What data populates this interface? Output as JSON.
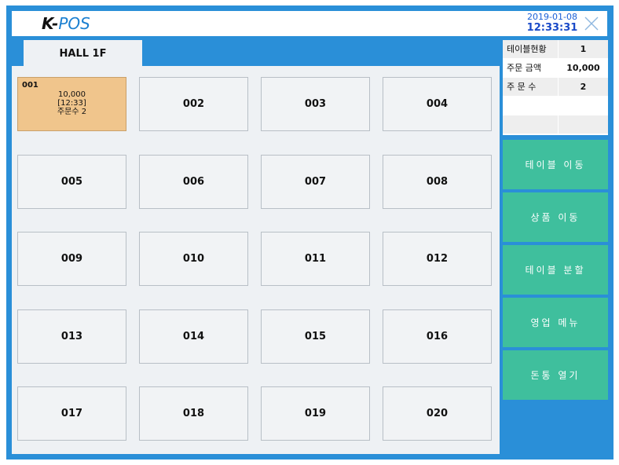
{
  "app": {
    "logo_k": "K-",
    "logo_pos": "POS",
    "date": "2019-01-08",
    "time": "12:33:31",
    "close_icon": "close-icon"
  },
  "colors": {
    "frame": "#2a8fd8",
    "occupied": "#f0c58c",
    "action": "#3fbf9d",
    "area": "#eef1f4"
  },
  "floor_tab": {
    "label": "HALL 1F"
  },
  "occupied_table": {
    "number": "001",
    "amount": "10,000",
    "time": "[12:33]",
    "orders": "주문수 2"
  },
  "tables": [
    "002",
    "003",
    "004",
    "005",
    "006",
    "007",
    "008",
    "009",
    "010",
    "011",
    "012",
    "013",
    "014",
    "015",
    "016",
    "017",
    "018",
    "019",
    "020"
  ],
  "info_panel": {
    "rows": [
      {
        "label": "테이블현황",
        "value": "1"
      },
      {
        "label": "주문 금액",
        "value": "10,000"
      },
      {
        "label": "주 문 수",
        "value": "2"
      },
      {
        "label": "",
        "value": ""
      },
      {
        "label": "",
        "value": ""
      }
    ]
  },
  "actions": [
    "테이블 이동",
    "상품 이동",
    "테이블 분할",
    "영업 메뉴",
    "돈통 열기"
  ]
}
